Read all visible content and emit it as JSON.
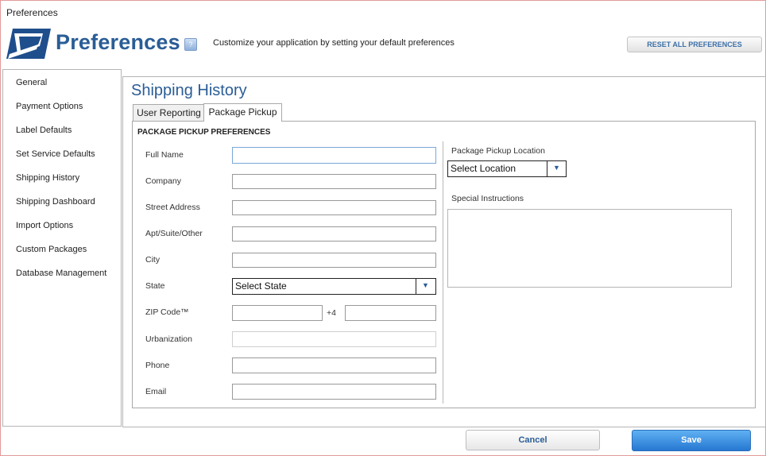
{
  "window": {
    "title": "Preferences"
  },
  "header": {
    "brand_title": "Preferences",
    "subtitle": "Customize your application by setting your default preferences",
    "reset_label": "RESET ALL PREFERENCES",
    "help_icon": "help-icon",
    "logo_icon": "eagle-logo-icon"
  },
  "sidebar": {
    "items": [
      {
        "label": "General"
      },
      {
        "label": "Payment Options"
      },
      {
        "label": "Label Defaults"
      },
      {
        "label": "Set Service Defaults"
      },
      {
        "label": "Shipping History"
      },
      {
        "label": "Shipping Dashboard"
      },
      {
        "label": "Import Options"
      },
      {
        "label": "Custom Packages"
      },
      {
        "label": "Database Management"
      }
    ]
  },
  "main": {
    "section_title": "Shipping History",
    "tabs": [
      {
        "label": "User Reporting",
        "active": false
      },
      {
        "label": "Package Pickup",
        "active": true
      }
    ],
    "group_title": "PACKAGE PICKUP PREFERENCES",
    "fields": {
      "full_name": {
        "label": "Full Name",
        "value": ""
      },
      "company": {
        "label": "Company",
        "value": ""
      },
      "street": {
        "label": "Street Address",
        "value": ""
      },
      "apt": {
        "label": "Apt/Suite/Other",
        "value": ""
      },
      "city": {
        "label": "City",
        "value": ""
      },
      "state": {
        "label": "State",
        "selected": "Select State"
      },
      "zip": {
        "label": "ZIP Code™",
        "value": "",
        "plus4_label": "+4",
        "plus4_value": ""
      },
      "urbanization": {
        "label": "Urbanization",
        "value": ""
      },
      "phone": {
        "label": "Phone",
        "value": ""
      },
      "email": {
        "label": "Email",
        "value": ""
      }
    },
    "pickup_location": {
      "label": "Package Pickup Location",
      "selected": "Select Location"
    },
    "special_instructions": {
      "label": "Special Instructions",
      "value": ""
    }
  },
  "footer": {
    "cancel_label": "Cancel",
    "save_label": "Save"
  },
  "colors": {
    "accent": "#2a5d96",
    "save_button": "#2678d2",
    "window_border": "#e39a9a"
  }
}
